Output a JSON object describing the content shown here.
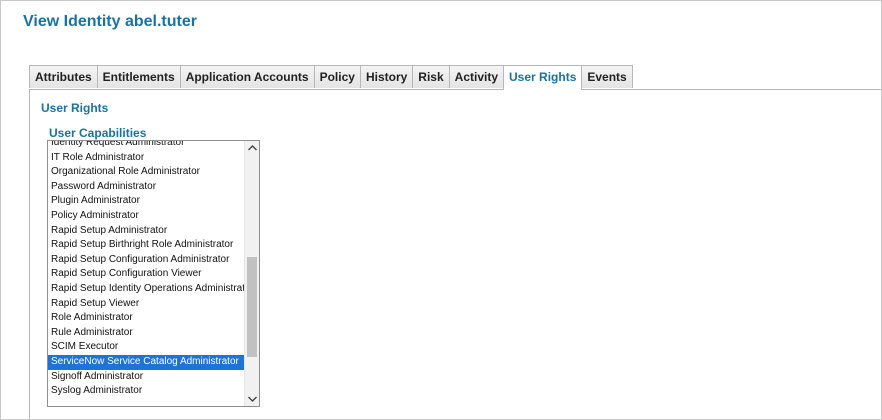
{
  "page": {
    "title": "View Identity abel.tuter"
  },
  "tabs": [
    {
      "label": "Attributes"
    },
    {
      "label": "Entitlements"
    },
    {
      "label": "Application Accounts"
    },
    {
      "label": "Policy"
    },
    {
      "label": "History"
    },
    {
      "label": "Risk"
    },
    {
      "label": "Activity"
    },
    {
      "label": "User Rights",
      "active": true
    },
    {
      "label": "Events"
    }
  ],
  "user_rights": {
    "section_title": "User Rights",
    "capabilities_label": "User Capabilities",
    "selected": "ServiceNow Service Catalog Administrator",
    "items": [
      "Identity Request Administrator",
      "IT Role Administrator",
      "Organizational Role Administrator",
      "Password Administrator",
      "Plugin Administrator",
      "Policy Administrator",
      "Rapid Setup Administrator",
      "Rapid Setup Birthright Role Administrator",
      "Rapid Setup Configuration Administrator",
      "Rapid Setup Configuration Viewer",
      "Rapid Setup Identity Operations Administrator",
      "Rapid Setup Viewer",
      "Role Administrator",
      "Rule Administrator",
      "SCIM Executor",
      "ServiceNow Service Catalog Administrator",
      "Signoff Administrator",
      "Syslog Administrator"
    ]
  },
  "icons": {
    "scroll_up": "chevron-up-icon",
    "scroll_down": "chevron-down-icon"
  },
  "colors": {
    "accent": "#1a72a3",
    "selection": "#1e73d6"
  }
}
